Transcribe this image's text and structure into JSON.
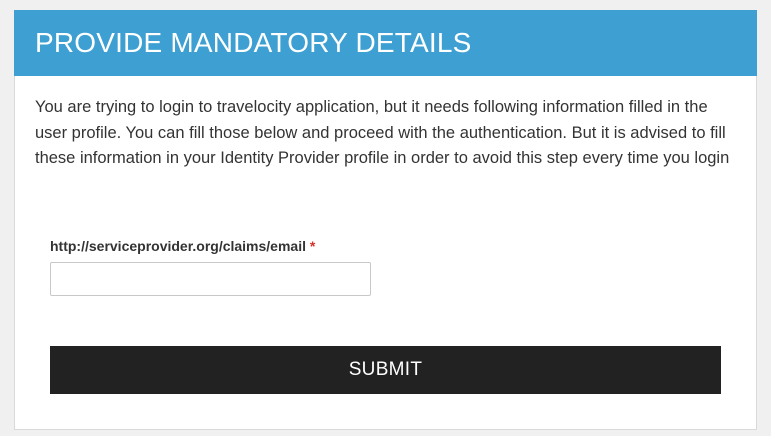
{
  "header": {
    "title": "PROVIDE MANDATORY DETAILS"
  },
  "intro": {
    "text": "You are trying to login to travelocity application, but it needs following information filled in the user profile. You can fill those below and proceed with the authentication. But it is advised to fill these information in your Identity Provider profile in order to avoid this step every time you login"
  },
  "form": {
    "email_field": {
      "label": "http://serviceprovider.org/claims/email",
      "required_mark": "*",
      "value": "",
      "placeholder": ""
    },
    "submit_label": "SUBMIT"
  },
  "colors": {
    "header_bg": "#3ea0d2",
    "button_bg": "#222222",
    "required": "#d9302a"
  }
}
